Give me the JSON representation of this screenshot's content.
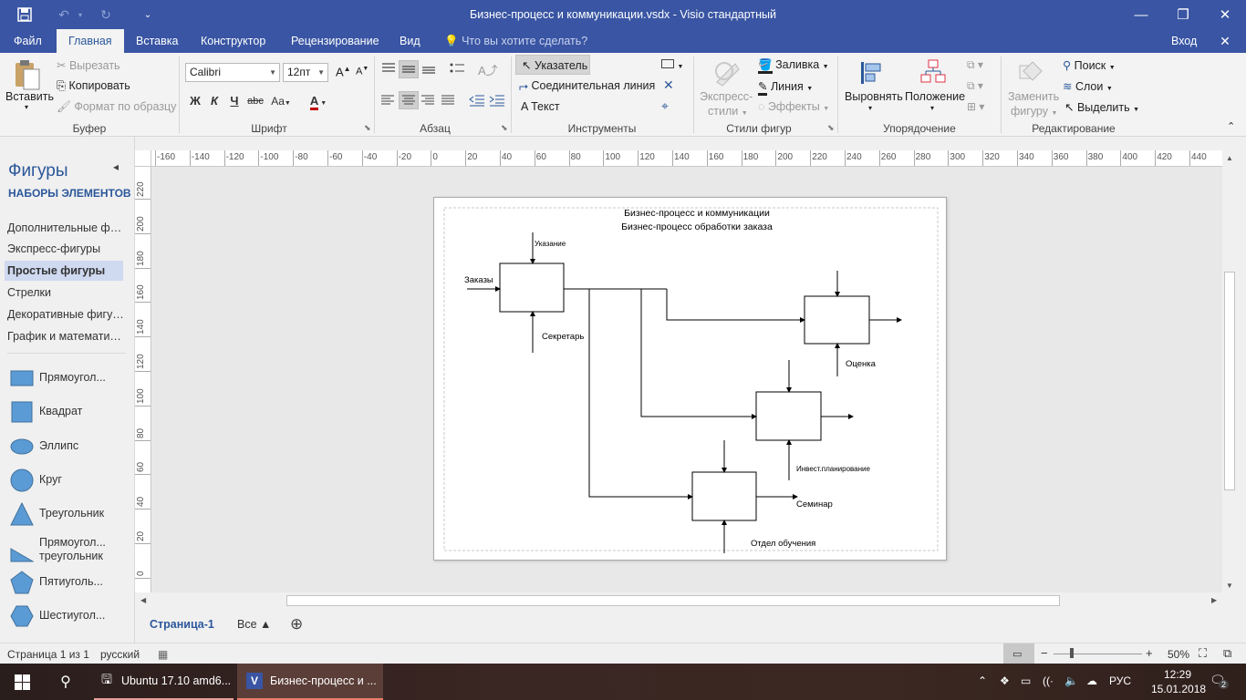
{
  "window": {
    "title": "Бизнес-процесс и коммуникации.vsdx - Visio стандартный",
    "minimize": "—",
    "restore": "❐",
    "close": "✕"
  },
  "tabs": [
    "Файл",
    "Главная",
    "Вставка",
    "Конструктор",
    "Рецензирование",
    "Вид"
  ],
  "tell_me": "Что вы хотите сделать?",
  "sign_in": "Вход",
  "ribbon": {
    "clipboard": {
      "paste": "Вставить",
      "cut": "Вырезать",
      "copy": "Копировать",
      "format_painter": "Формат по образцу",
      "label": "Буфер обмена"
    },
    "font": {
      "name": "Calibri",
      "size": "12пт",
      "bold": "Ж",
      "italic": "К",
      "underline": "Ч",
      "strike": "abc",
      "aa": "Aa",
      "color_a": "A",
      "label": "Шрифт"
    },
    "paragraph": {
      "label": "Абзац"
    },
    "tools": {
      "pointer": "Указатель",
      "connector": "Соединительная линия",
      "text": "Текст",
      "label": "Инструменты"
    },
    "shape_styles": {
      "quick_styles_line1": "Экспресс-",
      "quick_styles_line2": "стили",
      "fill": "Заливка",
      "line": "Линия",
      "effects": "Эффекты",
      "label": "Стили фигур"
    },
    "arrange": {
      "align": "Выровнять",
      "position": "Положение",
      "label": "Упорядочение"
    },
    "editing": {
      "change_shape_line1": "Заменить",
      "change_shape_line2": "фигуру",
      "find": "Поиск",
      "layers": "Слои",
      "select": "Выделить",
      "label": "Редактирование"
    }
  },
  "shapes_panel": {
    "title": "Фигуры",
    "subtitle": "НАБОРЫ ЭЛЕМЕНТОВ",
    "stencils": [
      {
        "label": "Дополнительные фиг..."
      },
      {
        "label": "Экспресс-фигуры"
      },
      {
        "label": "Простые фигуры"
      },
      {
        "label": "Стрелки"
      },
      {
        "label": "Декоративные фигуры"
      },
      {
        "label": "График и математиче..."
      }
    ],
    "shapes": [
      {
        "label": "Прямоугол..."
      },
      {
        "label": "Квадрат"
      },
      {
        "label": "Эллипс"
      },
      {
        "label": "Круг"
      },
      {
        "label": "Треугольник"
      },
      {
        "label": "Прямоугол... треугольник"
      },
      {
        "label": "Пятиуголь..."
      },
      {
        "label": "Шестиугол..."
      }
    ],
    "shape_color": "#5b9bd5"
  },
  "ruler": {
    "h_labels": [
      "-160",
      "-140",
      "-120",
      "-100",
      "-80",
      "-60",
      "-40",
      "-20",
      "0",
      "20",
      "40",
      "60",
      "80",
      "100",
      "120",
      "140",
      "160",
      "180",
      "200",
      "220",
      "240",
      "260",
      "280",
      "300",
      "320",
      "340",
      "360",
      "380",
      "400",
      "420",
      "440"
    ],
    "v_labels": [
      "220",
      "200",
      "180",
      "160",
      "140",
      "120",
      "100",
      "80",
      "60",
      "40",
      "20",
      "0"
    ]
  },
  "diagram": {
    "title1": "Бизнес-процесс и коммуникации",
    "title2": "Бизнес-процесс обработки заказа",
    "labels": {
      "instruction": "Указание",
      "orders": "Заказы",
      "secretary": "Секретарь",
      "evaluation": "Оценка",
      "invest": "Инвест.планирование",
      "seminar": "Семинар",
      "training": "Отдел обучения"
    }
  },
  "pages": {
    "current": "Страница-1",
    "all": "Все ▲",
    "add": "⊕"
  },
  "status": {
    "page": "Страница 1 из 1",
    "lang": "русский",
    "zoom": "50%"
  },
  "taskbar": {
    "ubuntu": "Ubuntu 17.10 amd6...",
    "visio": "Бизнес-процесс и ...",
    "lang": "РУС",
    "time": "12:29",
    "date": "15.01.2018",
    "notif": "2"
  }
}
